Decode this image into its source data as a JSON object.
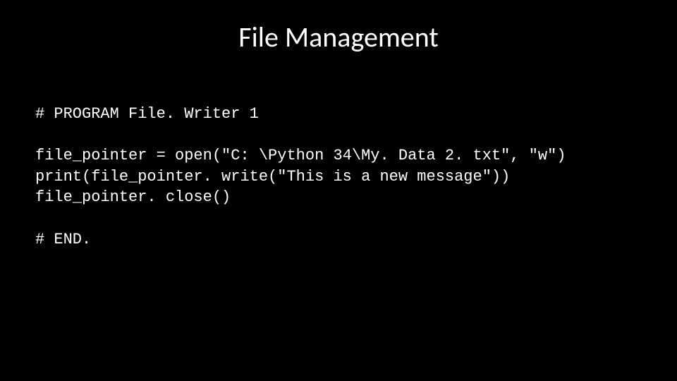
{
  "title": "File Management",
  "code": {
    "line1": "# PROGRAM File. Writer 1",
    "blank1": "",
    "line2": "file_pointer = open(\"C: \\Python 34\\My. Data 2. txt\", \"w\")",
    "line3": "print(file_pointer. write(\"This is a new message\"))",
    "line4": "file_pointer. close()",
    "blank2": "",
    "line5": "# END."
  }
}
